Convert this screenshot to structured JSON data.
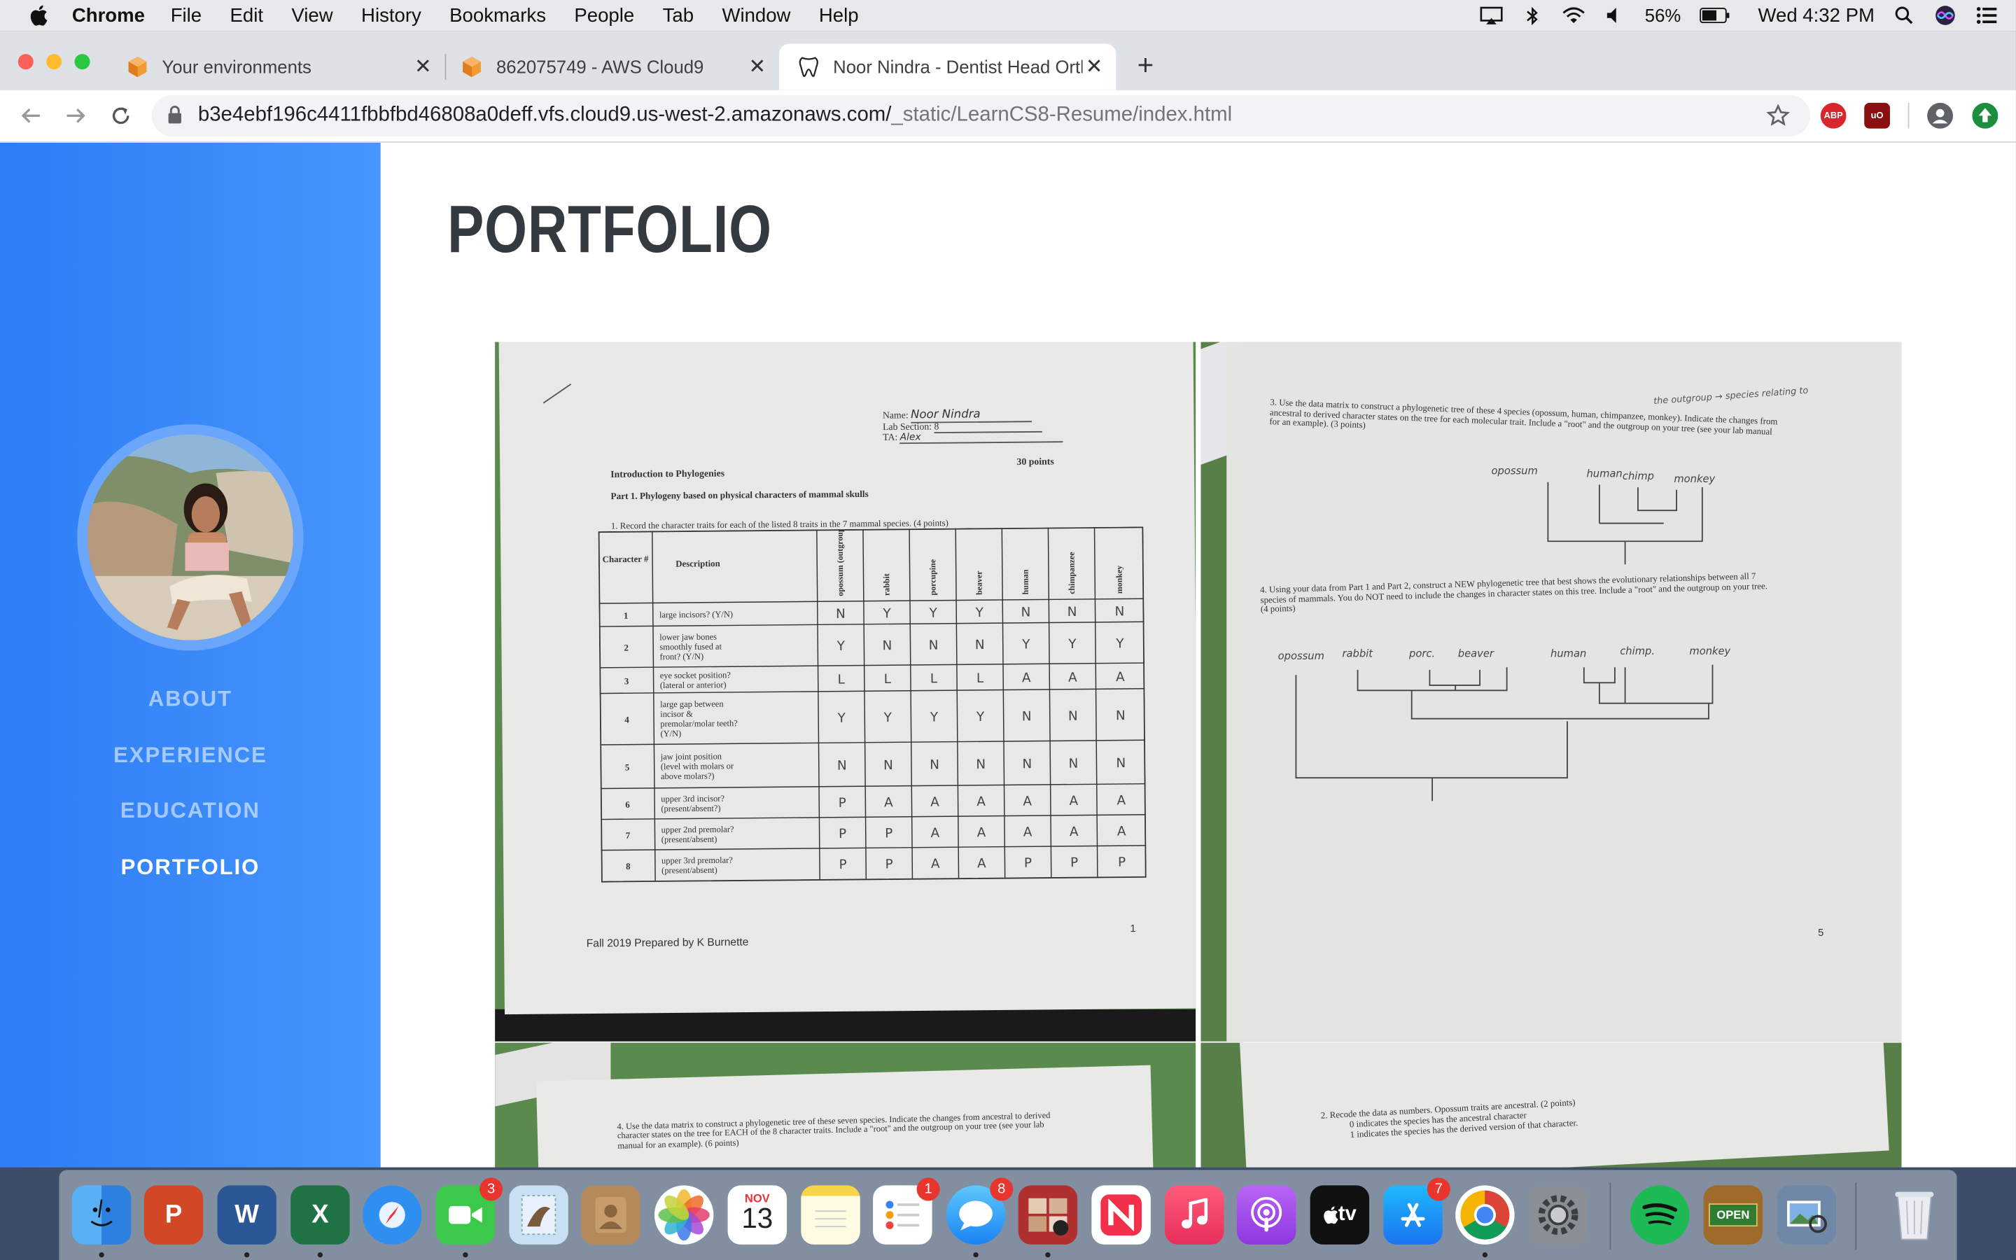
{
  "menubar": {
    "app": "Chrome",
    "items": [
      "File",
      "Edit",
      "View",
      "History",
      "Bookmarks",
      "People",
      "Tab",
      "Window",
      "Help"
    ],
    "battery": "56%",
    "clock": "Wed 4:32 PM"
  },
  "tabs": [
    {
      "title": "Your environments"
    },
    {
      "title": "862075749 - AWS Cloud9"
    },
    {
      "title": "Noor Nindra - Dentist Head Orth"
    }
  ],
  "address": {
    "domain": "b3e4ebf196c4411fbbfbd46808a0deff.vfs.cloud9.us-west-2.amazonaws.com/",
    "path": "_static/LearnCS8-Resume/index.html"
  },
  "extensions": {
    "abp": "ABP",
    "ublock": "uO"
  },
  "sidebar": {
    "nav": [
      "ABOUT",
      "EXPERIENCE",
      "EDUCATION",
      "PORTFOLIO"
    ],
    "active": "PORTFOLIO"
  },
  "main": {
    "title": "PORTFOLIO"
  },
  "worksheet1": {
    "name_label": "Name:",
    "name_value": "Noor Nindra",
    "lab_label": "Lab Section:",
    "lab_value": "8",
    "ta_label": "TA:",
    "ta_value": "Alex",
    "intro": "Introduction to Phylogenies",
    "points": "30 points",
    "part": "Part 1. Phylogeny based on physical characters of mammal skulls",
    "q1": "1.  Record the character traits for each of the listed 8 traits in the 7 mammal species. (4 points)",
    "headers": [
      "Character #",
      "Description",
      "opossum (outgroup)",
      "rabbit",
      "porcupine",
      "beaver",
      "human",
      "chimpanzee",
      "monkey"
    ],
    "rows": [
      {
        "n": "1",
        "d": "large incisors? (Y/N)",
        "v": [
          "N",
          "Y",
          "Y",
          "Y",
          "N",
          "N",
          "N"
        ]
      },
      {
        "n": "2",
        "d": "lower jaw bones smoothly fused at front? (Y/N)",
        "v": [
          "Y",
          "N",
          "N",
          "N",
          "Y",
          "Y",
          "Y"
        ]
      },
      {
        "n": "3",
        "d": "eye socket position? (lateral or anterior)",
        "v": [
          "L",
          "L",
          "L",
          "L",
          "A",
          "A",
          "A"
        ]
      },
      {
        "n": "4",
        "d": "large gap between incisor & premolar/molar teeth? (Y/N)",
        "v": [
          "Y",
          "Y",
          "Y",
          "Y",
          "N",
          "N",
          "N"
        ]
      },
      {
        "n": "5",
        "d": "jaw joint position (level with molars or above molars?)",
        "v": [
          "N",
          "N",
          "N",
          "N",
          "N",
          "N",
          "N"
        ]
      },
      {
        "n": "6",
        "d": "upper 3rd incisor? (present/absent?)",
        "v": [
          "P",
          "A",
          "A",
          "A",
          "A",
          "A",
          "A"
        ]
      },
      {
        "n": "7",
        "d": "upper 2nd premolar? (present/absent)",
        "v": [
          "P",
          "P",
          "A",
          "A",
          "A",
          "A",
          "A"
        ]
      },
      {
        "n": "8",
        "d": "upper 3rd premolar? (present/absent)",
        "v": [
          "P",
          "P",
          "A",
          "A",
          "P",
          "P",
          "P"
        ]
      }
    ],
    "footer": "Fall 2019 Prepared by K Burnette",
    "page": "1"
  },
  "worksheet2": {
    "q3": "3.  Use the data matrix to construct a phylogenetic tree of these 4 species (opossum, human, chimpanzee, monkey). Indicate the changes from ancestral to derived character states on the tree for each molecular trait. Include a \"root\" and the outgroup on your tree (see your lab manual for an example). (3 points)",
    "note": "the outgroup → species relating to",
    "tree1_labels": [
      "opossum",
      "human",
      "chimp",
      "monkey"
    ],
    "q4": "4.  Using your data from Part 1 and Part 2, construct a NEW phylogenetic tree that best shows the evolutionary relationships between all 7 species of mammals. You do NOT need to include the changes in character states on this tree. Include a \"root\" and the outgroup on your tree. (4 points)",
    "tree2_labels": [
      "opossum",
      "rabbit",
      "porc.",
      "beaver",
      "human",
      "chimp.",
      "monkey"
    ],
    "page": "5"
  },
  "worksheet3": {
    "q4": "4.  Use the data matrix to construct a phylogenetic tree of these seven species. Indicate the changes from ancestral to derived character states on the tree for EACH of the 8 character traits. Include a \"root\" and the outgroup on your tree (see your lab manual for an example). (6 points)"
  },
  "worksheet4": {
    "q2": "2.  Recode the data as numbers. Opossum traits are ancestral. (2 points)",
    "l1": "0 indicates the species has the ancestral character",
    "l2": "1 indicates the species has the derived version of that character."
  },
  "dock": {
    "calendar_month": "NOV",
    "calendar_day": "13",
    "facetime_badge": "3",
    "reminders_badge": "1",
    "messages_badge": "8",
    "appstore_badge": "7",
    "tv_label": "tv",
    "open_sign": "OPEN"
  },
  "colors": {
    "sidebar_start": "#2e7cf6",
    "sidebar_end": "#4696fb",
    "title": "#343a40",
    "table_green": "#5b8a4e"
  }
}
